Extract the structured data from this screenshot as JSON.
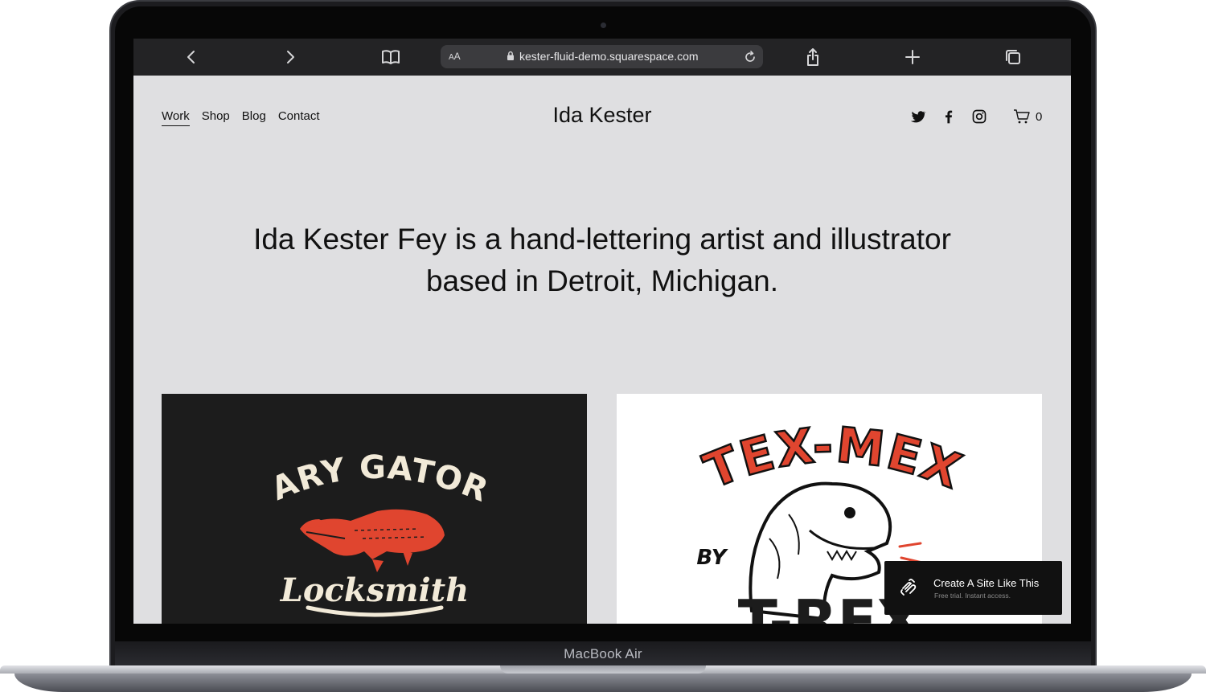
{
  "device": {
    "label": "MacBook Air"
  },
  "browser": {
    "text_size_button": "AA",
    "url": "kester-fluid-demo.squarespace.com",
    "icons": [
      "back-icon",
      "forward-icon",
      "bookmarks-icon",
      "lock-icon",
      "reload-icon",
      "share-icon",
      "new-tab-icon",
      "tabs-icon"
    ]
  },
  "site": {
    "title": "Ida Kester",
    "nav": [
      {
        "label": "Work",
        "active": true
      },
      {
        "label": "Shop",
        "active": false
      },
      {
        "label": "Blog",
        "active": false
      },
      {
        "label": "Contact",
        "active": false
      }
    ],
    "social_icons": [
      "twitter-icon",
      "facebook-icon",
      "instagram-icon"
    ],
    "cart_count": "0",
    "intro": "Ida Kester Fey is a hand-lettering artist and illustrator based in Detroit, Michigan."
  },
  "gallery": {
    "left": {
      "line1": "GARY GATORS",
      "line2": "Locksmith"
    },
    "right": {
      "line1": "TEX-MEX",
      "line2": "BY",
      "line3": "T-REX"
    }
  },
  "banner": {
    "title": "Create A Site Like This",
    "subtitle": "Free trial. Instant access."
  },
  "colors": {
    "accent_red": "#e0452f",
    "screen_bg": "#dfdfe1",
    "toolbar_bg": "#232325"
  }
}
